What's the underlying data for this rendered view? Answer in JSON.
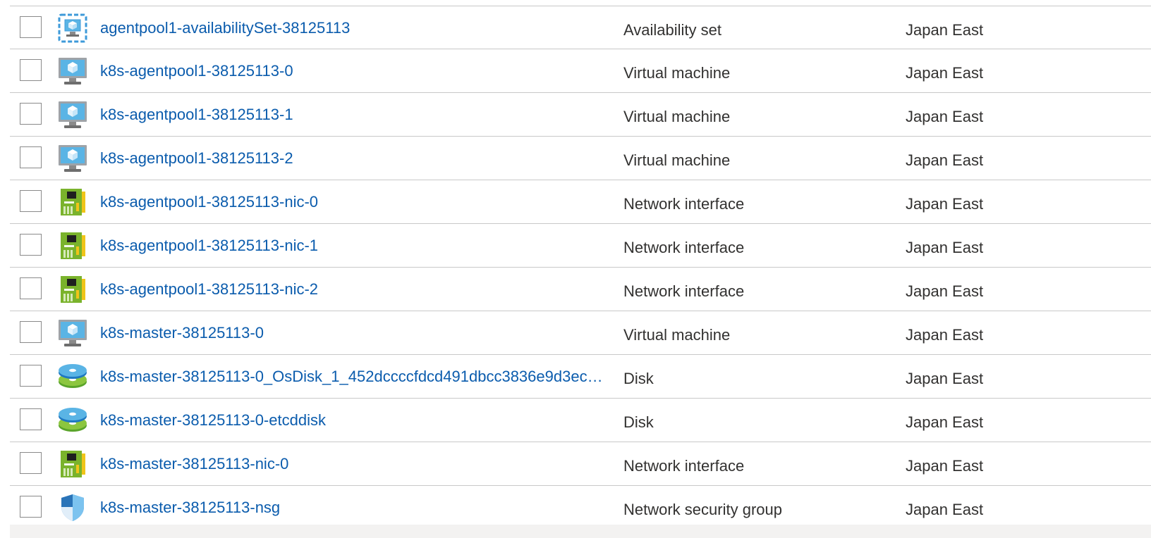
{
  "resources": [
    {
      "name": "agentpool1-availabilitySet-38125113",
      "type": "Availability set",
      "location": "Japan East",
      "icon": "availability-set-icon"
    },
    {
      "name": "k8s-agentpool1-38125113-0",
      "type": "Virtual machine",
      "location": "Japan East",
      "icon": "virtual-machine-icon"
    },
    {
      "name": "k8s-agentpool1-38125113-1",
      "type": "Virtual machine",
      "location": "Japan East",
      "icon": "virtual-machine-icon"
    },
    {
      "name": "k8s-agentpool1-38125113-2",
      "type": "Virtual machine",
      "location": "Japan East",
      "icon": "virtual-machine-icon"
    },
    {
      "name": "k8s-agentpool1-38125113-nic-0",
      "type": "Network interface",
      "location": "Japan East",
      "icon": "network-interface-icon"
    },
    {
      "name": "k8s-agentpool1-38125113-nic-1",
      "type": "Network interface",
      "location": "Japan East",
      "icon": "network-interface-icon"
    },
    {
      "name": "k8s-agentpool1-38125113-nic-2",
      "type": "Network interface",
      "location": "Japan East",
      "icon": "network-interface-icon"
    },
    {
      "name": "k8s-master-38125113-0",
      "type": "Virtual machine",
      "location": "Japan East",
      "icon": "virtual-machine-icon"
    },
    {
      "name": "k8s-master-38125113-0_OsDisk_1_452dccccfdcd491dbcc3836e9d3ec…",
      "type": "Disk",
      "location": "Japan East",
      "icon": "disk-icon"
    },
    {
      "name": "k8s-master-38125113-0-etcddisk",
      "type": "Disk",
      "location": "Japan East",
      "icon": "disk-icon"
    },
    {
      "name": "k8s-master-38125113-nic-0",
      "type": "Network interface",
      "location": "Japan East",
      "icon": "network-interface-icon"
    },
    {
      "name": "k8s-master-38125113-nsg",
      "type": "Network security group",
      "location": "Japan East",
      "icon": "network-security-group-icon"
    }
  ],
  "colors": {
    "link": "#0b5cad",
    "text": "#323130",
    "divider": "#c8c8c8",
    "vm_blue": "#5ab4e5",
    "nic_green": "#7ab32c",
    "shield_blue": "#3a8fd6"
  }
}
